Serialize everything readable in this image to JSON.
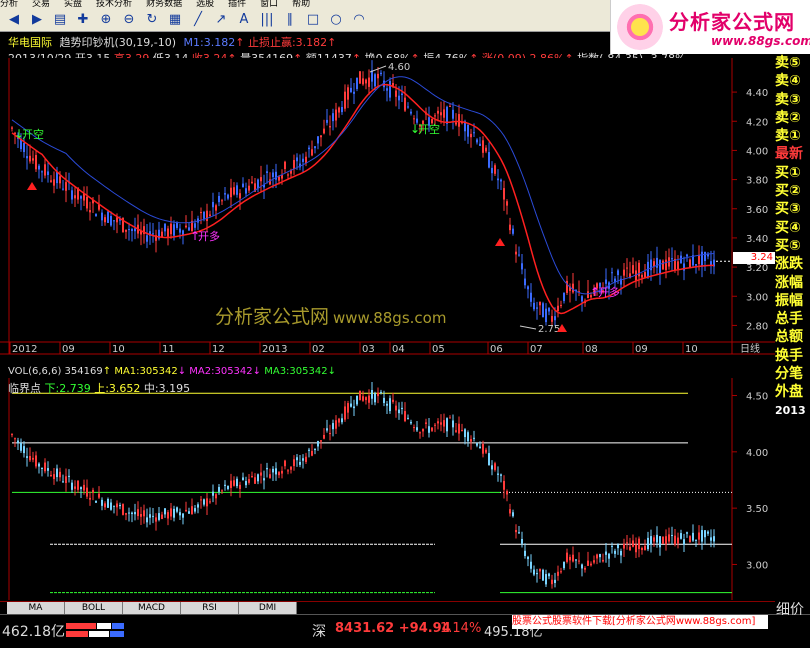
{
  "menu": [
    "分析",
    "交易",
    "实盘",
    "技术分析",
    "财务数据",
    "选股",
    "插件",
    "窗口",
    "帮助"
  ],
  "toolbar_icons": [
    "back-icon",
    "forward-icon",
    "chart-icon",
    "cross-icon",
    "zoom-in-icon",
    "zoom-out-icon",
    "refresh-icon",
    "grid-icon",
    "line-icon",
    "ray-icon",
    "text-icon",
    "bar-icon",
    "parallel-icon",
    "rect-icon",
    "circle-icon",
    "arc-icon"
  ],
  "logo": {
    "name": "分析家公式网",
    "url": "www.88gs.com"
  },
  "header": {
    "stock_name": "华电国际",
    "indicator": "趋势印钞机",
    "params": "(30,19,-10)",
    "m1": "M1:3.182",
    "stop": "止损止赢:3.182",
    "date": "2013/10/29",
    "open_l": "开",
    "open": "3.15",
    "high_l": "高",
    "high": "3.29",
    "low_l": "低",
    "low": "3.14",
    "close_l": "收",
    "close": "3.24",
    "vol_l": "量",
    "vol": "354169",
    "amt_l": "额",
    "amt": "11437",
    "turn_l": "换",
    "turn": "0.68%",
    "amp_l": "振",
    "amp": "4.76%",
    "chg_l": "涨",
    "chg": "(0.09)",
    "chg_pct": "2.86%",
    "index_l": "指数",
    "index": "(-84.35)",
    "index_pct": "-3.78%"
  },
  "main_chart": {
    "y_ticks": [
      "4.40",
      "4.20",
      "4.00",
      "3.80",
      "3.60",
      "3.40",
      "3.20",
      "3.00",
      "2.80"
    ],
    "x_labels": [
      "2012",
      "09",
      "10",
      "11",
      "12",
      "2013",
      "02",
      "03",
      "04",
      "05",
      "06",
      "07",
      "08",
      "09",
      "10"
    ],
    "period": "日线",
    "high_mark": "4.60",
    "low_mark": "2.75",
    "signals": [
      {
        "text": "开空",
        "type": "short"
      },
      {
        "text": "开多",
        "type": "long"
      },
      {
        "text": "开空",
        "type": "short"
      },
      {
        "text": "开多",
        "type": "long"
      }
    ],
    "price_tag": "3.24"
  },
  "vol_info": {
    "label": "VOL(6,6,6)",
    "value": "354169",
    "ma1": "MA1:305342",
    "ma2": "MA2:305342",
    "ma3": "MA3:305342"
  },
  "sub_chart": {
    "title": "临界点",
    "lower": "下:2.739",
    "upper": "上:3.652",
    "mid": "中:3.195",
    "y_ticks": [
      "4.50",
      "4.00",
      "3.50",
      "3.00"
    ]
  },
  "quote_panel": [
    {
      "text": "卖⑤",
      "color": "yellow"
    },
    {
      "text": "卖④",
      "color": "yellow"
    },
    {
      "text": "卖③",
      "color": "yellow"
    },
    {
      "text": "卖②",
      "color": "yellow"
    },
    {
      "text": "卖①",
      "color": "yellow"
    },
    {
      "text": "最新",
      "color": "red"
    },
    {
      "text": "买①",
      "color": "yellow"
    },
    {
      "text": "买②",
      "color": "yellow"
    },
    {
      "text": "买③",
      "color": "yellow"
    },
    {
      "text": "买④",
      "color": "yellow"
    },
    {
      "text": "买⑤",
      "color": "yellow"
    },
    {
      "text": "涨跌",
      "color": "yellow"
    },
    {
      "text": "涨幅",
      "color": "yellow"
    },
    {
      "text": "振幅",
      "color": "yellow"
    },
    {
      "text": "总手",
      "color": "yellow"
    },
    {
      "text": "总额",
      "color": "yellow"
    },
    {
      "text": "换手",
      "color": "yellow"
    },
    {
      "text": "分笔",
      "color": "yellow"
    },
    {
      "text": "外盘",
      "color": "yellow"
    },
    {
      "text": "2013",
      "color": "date"
    }
  ],
  "watermark": {
    "cn": "分析家公式网",
    "url": "www.88gs.com"
  },
  "tabs": [
    "MA",
    "BOLL",
    "MACD",
    "RSI",
    "DMI"
  ],
  "status": {
    "amount": "462.18亿",
    "market": "深",
    "index": "8431.62",
    "change": "+94.94",
    "pct": "1.14%",
    "volume": "495.18亿",
    "ad": "股票公式股票软件下载[分析家公式网www.88gs.com]",
    "cut_label": "细价"
  },
  "colors": {
    "up": "#ff3b3b",
    "down": "#3b6bff",
    "ma_red": "#ff2020",
    "ma_blue": "#2b4bd8",
    "text_yellow": "#ffff33"
  }
}
